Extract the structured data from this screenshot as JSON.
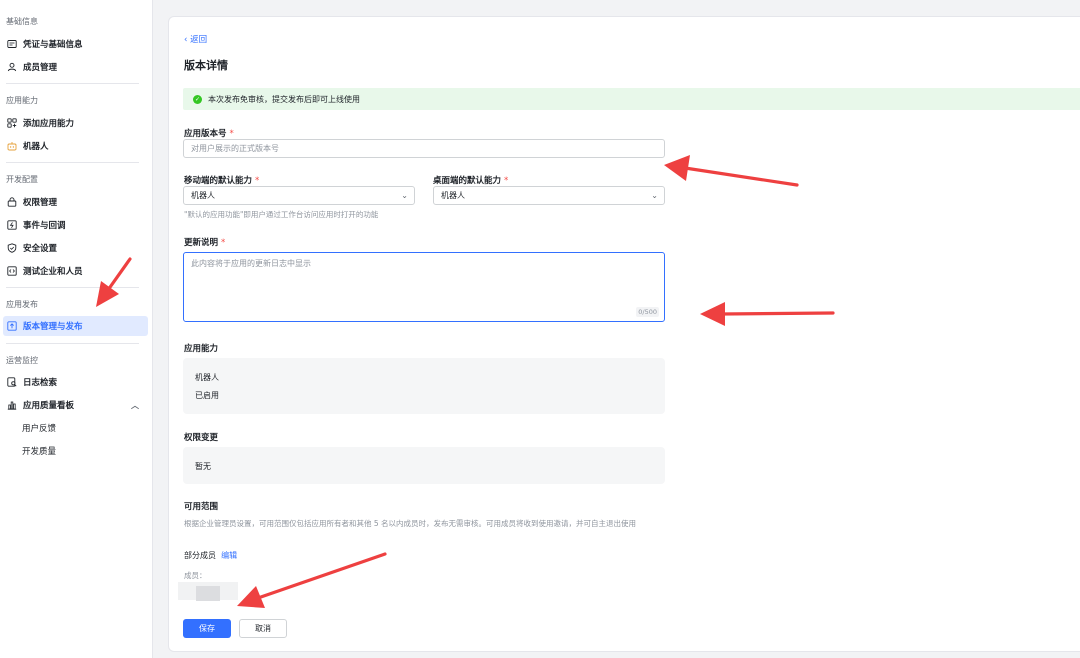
{
  "sidebar": {
    "groups": [
      {
        "title": "基础信息",
        "items": [
          "凭证与基础信息",
          "成员管理"
        ]
      },
      {
        "title": "应用能力",
        "items": [
          "添加应用能力",
          "机器人"
        ]
      },
      {
        "title": "开发配置",
        "items": [
          "权限管理",
          "事件与回调",
          "安全设置",
          "测试企业和人员"
        ]
      },
      {
        "title": "应用发布",
        "items": [
          "版本管理与发布"
        ]
      },
      {
        "title": "运营监控",
        "items": [
          "日志检索",
          "应用质量看板"
        ],
        "subitems": [
          "用户反馈",
          "开发质量"
        ]
      }
    ]
  },
  "main": {
    "back_label": "返回",
    "title": "版本详情",
    "notice": "本次发布免审核，提交发布后即可上线使用",
    "version_label": "应用版本号",
    "version_placeholder": "对用户展示的正式版本号",
    "mobile_label": "移动端的默认能力",
    "mobile_value": "机器人",
    "desktop_label": "桌面端的默认能力",
    "desktop_value": "机器人",
    "default_hint": "\"默认的应用功能\"即用户通过工作台访问应用时打开的功能",
    "update_label": "更新说明",
    "update_placeholder": "此内容将于应用的更新日志中显示",
    "update_counter": "0/500",
    "ability_label": "应用能力",
    "ability_name": "机器人",
    "ability_status": "已启用",
    "perm_label": "权限变更",
    "perm_value": "暂无",
    "scope_label": "可用范围",
    "scope_desc": "根据企业管理员设置，可用范围仅包括应用所有者和其他 5 名以内成员时，发布无需审核。可用成员将收到使用邀请，并可自主退出使用",
    "scope_part": "部分成员",
    "scope_edit": "编辑",
    "members_label": "成员：",
    "save": "保存",
    "cancel": "取消",
    "required_mark": "*"
  },
  "colors": {
    "accent": "#3370ff",
    "arrow": "#ee4040",
    "success": "#34c724"
  }
}
